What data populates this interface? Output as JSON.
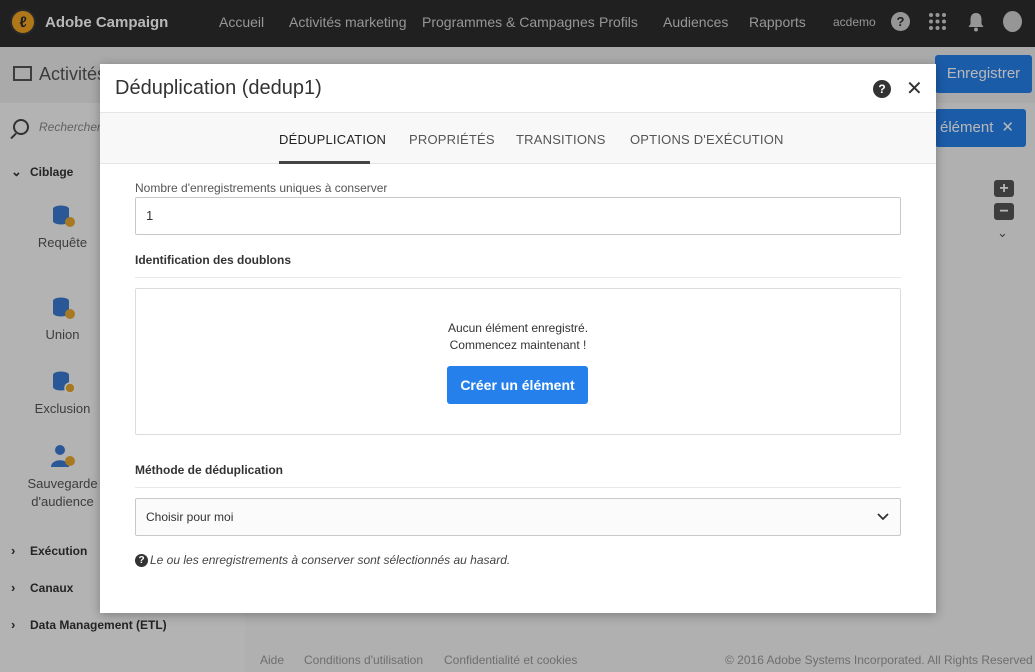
{
  "app": {
    "brand": "Adobe Campaign",
    "user": "acdemo"
  },
  "nav": [
    "Accueil",
    "Activités marketing",
    "Programmes & Campagnes",
    "Profils",
    "Audiences",
    "Rapports"
  ],
  "page": {
    "title": "Activités",
    "save_label": "Enregistrer",
    "element_label": "élément"
  },
  "sidebar": {
    "search_placeholder": "Rechercher...",
    "sections": [
      "Ciblage",
      "Exécution",
      "Canaux",
      "Data Management (ETL)"
    ],
    "tools": [
      "Requête",
      "Union",
      "Exclusion",
      "Sauvegarde d'audience"
    ]
  },
  "footer": {
    "links": [
      "Aide",
      "Conditions d'utilisation",
      "Confidentialité et cookies"
    ],
    "copyright": "© 2016 Adobe Systems Incorporated. All Rights Reserved"
  },
  "modal": {
    "title": "Déduplication (dedup1)",
    "tabs": [
      "DÉDUPLICATION",
      "PROPRIÉTÉS",
      "TRANSITIONS",
      "OPTIONS D'EXÉCUTION"
    ],
    "active_tab": "DÉDUPLICATION",
    "unique_label": "Nombre d'enregistrements uniques à conserver",
    "unique_value": "1",
    "duplicates_heading": "Identification des doublons",
    "empty_line1": "Aucun élément enregistré.",
    "empty_line2": "Commencez maintenant !",
    "create_label": "Créer un élément",
    "method_heading": "Méthode de déduplication",
    "method_value": "Choisir pour moi",
    "hint": "Le ou les enregistrements à conserver sont sélectionnés au hasard."
  },
  "colors": {
    "topbar": "#2d2d2d",
    "accent": "#2680eb",
    "brand_logo": "#f4a623"
  }
}
